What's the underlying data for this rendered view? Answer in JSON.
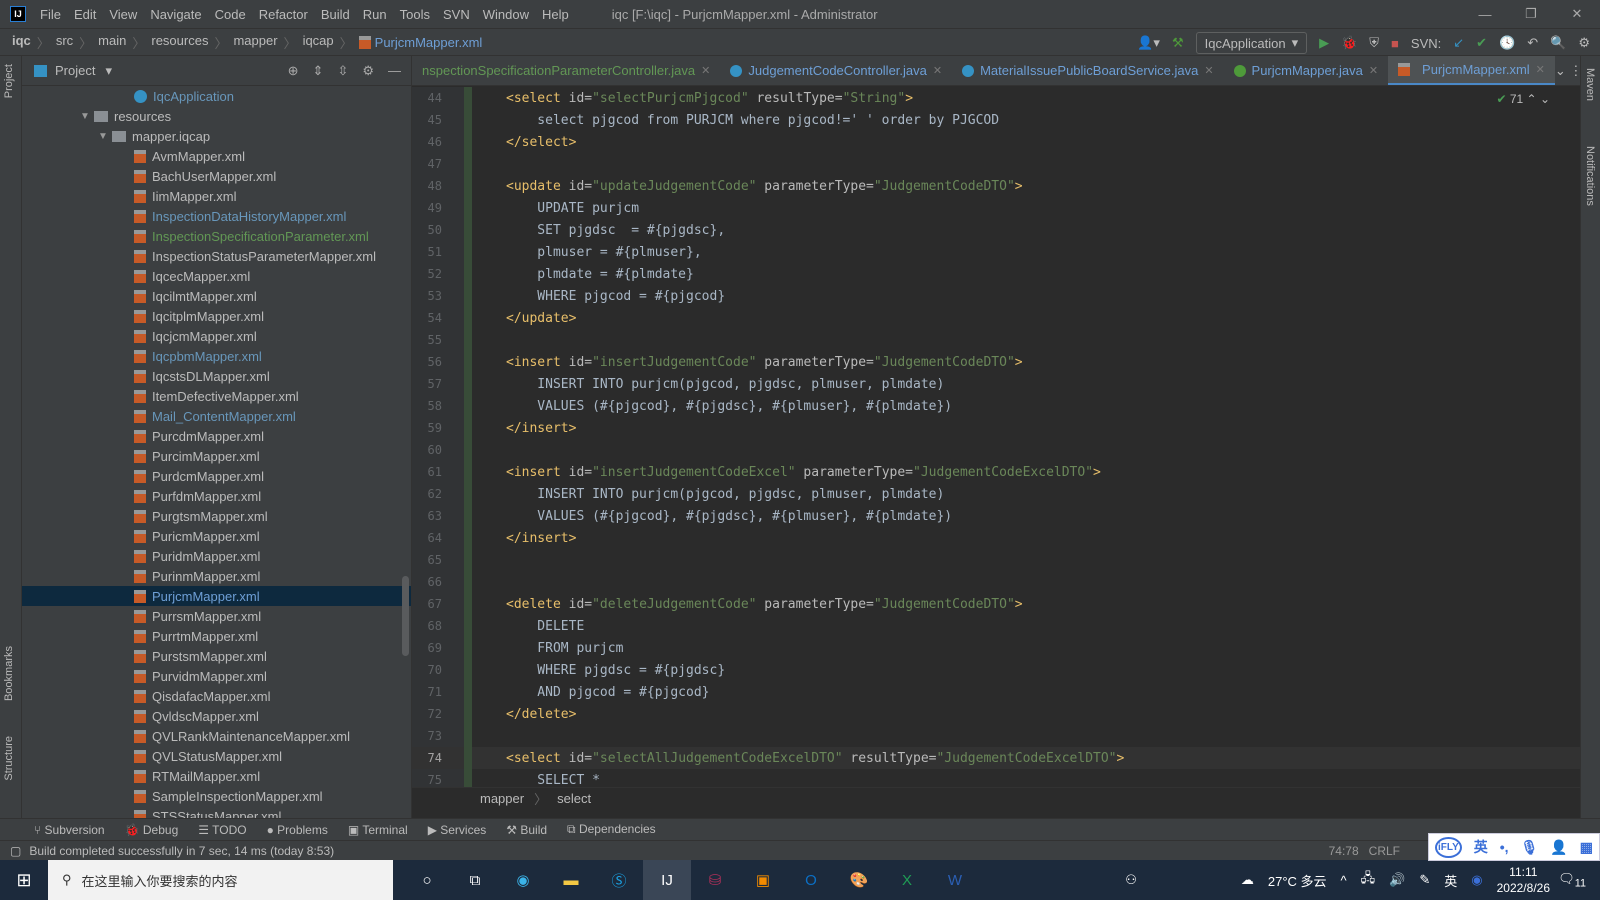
{
  "titlebar": {
    "logo": "IJ",
    "menu": [
      "File",
      "Edit",
      "View",
      "Navigate",
      "Code",
      "Refactor",
      "Build",
      "Run",
      "Tools",
      "SVN",
      "Window",
      "Help"
    ],
    "title": "iqc [F:\\iqc] - PurjcmMapper.xml - Administrator"
  },
  "breadcrumb": [
    "iqc",
    "src",
    "main",
    "resources",
    "mapper",
    "iqcap"
  ],
  "breadcrumb_file": "PurjcmMapper.xml",
  "toolbar": {
    "run_config": "IqcApplication",
    "svn_label": "SVN:"
  },
  "project": {
    "title": "Project",
    "app": "IqcApplication",
    "resources": "resources",
    "folder": "mapper.iqcap",
    "files": [
      {
        "name": "AvmMapper.xml",
        "c": ""
      },
      {
        "name": "BachUserMapper.xml",
        "c": ""
      },
      {
        "name": "IimMapper.xml",
        "c": ""
      },
      {
        "name": "InspectionDataHistoryMapper.xml",
        "c": "blue"
      },
      {
        "name": "InspectionSpecificationParameter.xml",
        "c": "green"
      },
      {
        "name": "InspectionStatusParameterMapper.xml",
        "c": ""
      },
      {
        "name": "IqcecMapper.xml",
        "c": ""
      },
      {
        "name": "IqcilmtMapper.xml",
        "c": ""
      },
      {
        "name": "IqcitplmMapper.xml",
        "c": ""
      },
      {
        "name": "IqcjcmMapper.xml",
        "c": ""
      },
      {
        "name": "IqcpbmMapper.xml",
        "c": "blue"
      },
      {
        "name": "IqcstsDLMapper.xml",
        "c": ""
      },
      {
        "name": "ItemDefectiveMapper.xml",
        "c": ""
      },
      {
        "name": "Mail_ContentMapper.xml",
        "c": "blue"
      },
      {
        "name": "PurcdmMapper.xml",
        "c": ""
      },
      {
        "name": "PurcimMapper.xml",
        "c": ""
      },
      {
        "name": "PurdcmMapper.xml",
        "c": ""
      },
      {
        "name": "PurfdmMapper.xml",
        "c": ""
      },
      {
        "name": "PurgtsmMapper.xml",
        "c": ""
      },
      {
        "name": "PuricmMapper.xml",
        "c": ""
      },
      {
        "name": "PuridmMapper.xml",
        "c": ""
      },
      {
        "name": "PurinmMapper.xml",
        "c": ""
      },
      {
        "name": "PurjcmMapper.xml",
        "c": "sel"
      },
      {
        "name": "PurrsmMapper.xml",
        "c": ""
      },
      {
        "name": "PurrtmMapper.xml",
        "c": ""
      },
      {
        "name": "PurstsmMapper.xml",
        "c": ""
      },
      {
        "name": "PurvidmMapper.xml",
        "c": ""
      },
      {
        "name": "QisdafacMapper.xml",
        "c": ""
      },
      {
        "name": "QvldscMapper.xml",
        "c": ""
      },
      {
        "name": "QVLRankMaintenanceMapper.xml",
        "c": ""
      },
      {
        "name": "QVLStatusMapper.xml",
        "c": ""
      },
      {
        "name": "RTMailMapper.xml",
        "c": ""
      },
      {
        "name": "SampleInspectionMapper.xml",
        "c": ""
      },
      {
        "name": "STSStatusMapper.xml",
        "c": ""
      }
    ]
  },
  "side_labels": {
    "project": "Project",
    "bookmarks": "Bookmarks",
    "structure": "Structure",
    "maven": "Maven",
    "notifications": "Notifications"
  },
  "tabs": [
    {
      "label": "nspectionSpecificationParameterController.java",
      "icon": "none",
      "color": "#629755"
    },
    {
      "label": "JudgementCodeController.java",
      "icon": "c"
    },
    {
      "label": "MaterialIssuePublicBoardService.java",
      "icon": "c"
    },
    {
      "label": "PurjcmMapper.java",
      "icon": "i"
    },
    {
      "label": "PurjcmMapper.xml",
      "icon": "xml",
      "active": true
    }
  ],
  "inspection_count": "71",
  "code": [
    {
      "n": "44",
      "tk": [
        [
          "t",
          "<select "
        ],
        [
          "a",
          "id="
        ],
        [
          "s",
          "\"selectPurjcmPjgcod\""
        ],
        [
          "a",
          " resultType="
        ],
        [
          "s",
          "\"String\""
        ],
        [
          "t",
          ">"
        ]
      ]
    },
    {
      "n": "45",
      "tk": [
        [
          "x",
          "    select pjgcod from PURJCM where pjgcod!=' ' order by PJGCOD"
        ]
      ]
    },
    {
      "n": "46",
      "tk": [
        [
          "t",
          "</select>"
        ]
      ]
    },
    {
      "n": "47",
      "tk": []
    },
    {
      "n": "48",
      "tk": [
        [
          "t",
          "<update "
        ],
        [
          "a",
          "id="
        ],
        [
          "s",
          "\"updateJudgementCode\""
        ],
        [
          "a",
          " parameterType="
        ],
        [
          "s",
          "\"JudgementCodeDTO\""
        ],
        [
          "t",
          ">"
        ]
      ]
    },
    {
      "n": "49",
      "tk": [
        [
          "x",
          "    UPDATE purjcm"
        ]
      ]
    },
    {
      "n": "50",
      "tk": [
        [
          "x",
          "    SET pjgdsc  = #{pjgdsc},"
        ]
      ]
    },
    {
      "n": "51",
      "tk": [
        [
          "x",
          "    plmuser = #{plmuser},"
        ]
      ]
    },
    {
      "n": "52",
      "tk": [
        [
          "x",
          "    plmdate = #{plmdate}"
        ]
      ]
    },
    {
      "n": "53",
      "tk": [
        [
          "x",
          "    WHERE pjgcod = #{pjgcod}"
        ]
      ]
    },
    {
      "n": "54",
      "tk": [
        [
          "t",
          "</update>"
        ]
      ]
    },
    {
      "n": "55",
      "tk": []
    },
    {
      "n": "56",
      "tk": [
        [
          "t",
          "<insert "
        ],
        [
          "a",
          "id="
        ],
        [
          "s",
          "\"insertJudgementCode\""
        ],
        [
          "a",
          " parameterType="
        ],
        [
          "s",
          "\"JudgementCodeDTO\""
        ],
        [
          "t",
          ">"
        ]
      ]
    },
    {
      "n": "57",
      "tk": [
        [
          "x",
          "    INSERT INTO purjcm(pjgcod, pjgdsc, plmuser, plmdate)"
        ]
      ]
    },
    {
      "n": "58",
      "tk": [
        [
          "x",
          "    VALUES (#{pjgcod}, #{pjgdsc}, #{plmuser}, #{plmdate})"
        ]
      ]
    },
    {
      "n": "59",
      "tk": [
        [
          "t",
          "</insert>"
        ]
      ]
    },
    {
      "n": "60",
      "tk": []
    },
    {
      "n": "61",
      "tk": [
        [
          "t",
          "<insert "
        ],
        [
          "a",
          "id="
        ],
        [
          "s",
          "\"insertJudgementCodeExcel\""
        ],
        [
          "a",
          " parameterType="
        ],
        [
          "s",
          "\"JudgementCodeExcelDTO\""
        ],
        [
          "t",
          ">"
        ]
      ]
    },
    {
      "n": "62",
      "tk": [
        [
          "x",
          "    INSERT INTO purjcm(pjgcod, pjgdsc, plmuser, plmdate)"
        ]
      ]
    },
    {
      "n": "63",
      "tk": [
        [
          "x",
          "    VALUES (#{pjgcod}, #{pjgdsc}, #{plmuser}, #{plmdate})"
        ]
      ]
    },
    {
      "n": "64",
      "tk": [
        [
          "t",
          "</insert>"
        ]
      ]
    },
    {
      "n": "65",
      "tk": []
    },
    {
      "n": "66",
      "tk": []
    },
    {
      "n": "67",
      "tk": [
        [
          "t",
          "<delete "
        ],
        [
          "a",
          "id="
        ],
        [
          "s",
          "\"deleteJudgementCode\""
        ],
        [
          "a",
          " parameterType="
        ],
        [
          "s",
          "\"JudgementCodeDTO\""
        ],
        [
          "t",
          ">"
        ]
      ]
    },
    {
      "n": "68",
      "tk": [
        [
          "x",
          "    DELETE"
        ]
      ]
    },
    {
      "n": "69",
      "tk": [
        [
          "x",
          "    FROM purjcm"
        ]
      ]
    },
    {
      "n": "70",
      "tk": [
        [
          "x",
          "    WHERE pjgdsc = #{pjgdsc}"
        ]
      ]
    },
    {
      "n": "71",
      "tk": [
        [
          "x",
          "    AND pjgcod = #{pjgcod}"
        ]
      ]
    },
    {
      "n": "72",
      "tk": [
        [
          "t",
          "</delete>"
        ]
      ]
    },
    {
      "n": "73",
      "tk": []
    },
    {
      "n": "74",
      "tk": [
        [
          "t",
          "<select "
        ],
        [
          "a",
          "id="
        ],
        [
          "s",
          "\"selectAllJudgementCodeExcelDTO\""
        ],
        [
          "a",
          " resultType="
        ],
        [
          "s",
          "\"JudgementCodeExcelDTO\""
        ],
        [
          "t",
          ">"
        ]
      ],
      "cur": true
    },
    {
      "n": "75",
      "tk": [
        [
          "x",
          "    SELECT *"
        ]
      ]
    }
  ],
  "editor_breadcrumb": [
    "mapper",
    "select"
  ],
  "bottom_tabs": [
    "Subversion",
    "Debug",
    "TODO",
    "Problems",
    "Terminal",
    "Services",
    "Build",
    "Dependencies"
  ],
  "status": {
    "message": "Build completed successfully in 7 sec, 14 ms (today 8:53)",
    "position": "74:78",
    "line_ending": "CRLF"
  },
  "ime": {
    "brand": "iFLY",
    "lang": "英"
  },
  "taskbar": {
    "search_placeholder": "在这里输入你要搜索的内容",
    "weather": "27°C 多云",
    "lang": "英",
    "time": "11:11",
    "date": "2022/8/26",
    "notif_count": "11"
  }
}
